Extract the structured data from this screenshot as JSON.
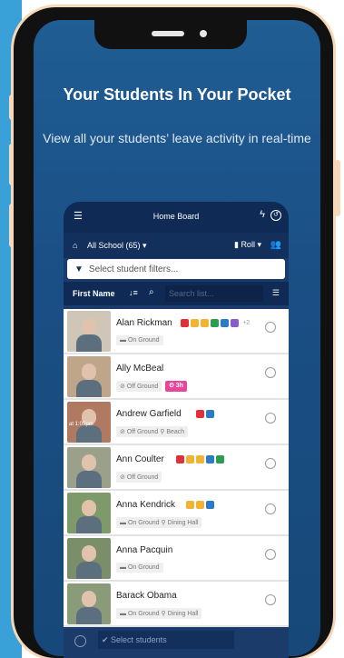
{
  "hero": {
    "headline": "Your Students In Your Pocket",
    "subline": "View all your students’ leave activity in real-time"
  },
  "app": {
    "topbar": {
      "title": "Home Board",
      "menu_icon": "hamburger-icon",
      "bolt_icon": "lightning-icon",
      "clock_icon": "clock-icon"
    },
    "school_selector": {
      "label": "All School (65)",
      "roll_label": "Roll",
      "people_icon": "group-icon"
    },
    "filter_placeholder": "Select student filters...",
    "sortbar": {
      "sort_field": "First Name",
      "search_placeholder": "Search list..."
    },
    "students": [
      {
        "name": "Alan Rickman",
        "tags": [
          "#e0303a",
          "#f2b233",
          "#f2b233",
          "#2a9d4e",
          "#2b7cc4",
          "#8b5cc9"
        ],
        "more": "+2",
        "status": "On Ground",
        "location": "",
        "time_badge": "",
        "photo_bg": "#cfc6b8",
        "overlay": ""
      },
      {
        "name": "Ally McBeal",
        "tags": [],
        "more": "",
        "status": "Off Ground",
        "location": "",
        "time_badge": "3h",
        "photo_bg": "#bfa58a",
        "overlay": ""
      },
      {
        "name": "Andrew Garfield",
        "tags": [
          "#e0303a",
          "#2b7cc4"
        ],
        "more": "",
        "status": "Off Ground",
        "location": "Beach",
        "time_badge": "",
        "photo_bg": "#b07a62",
        "overlay": "at 1:05pm"
      },
      {
        "name": "Ann Coulter",
        "tags": [
          "#e0303a",
          "#f2b233",
          "#f2b233",
          "#2b7cc4",
          "#2a9d4e"
        ],
        "more": "",
        "status": "Off Ground",
        "location": "",
        "time_badge": "",
        "photo_bg": "#9aa08a",
        "overlay": ""
      },
      {
        "name": "Anna Kendrick",
        "tags": [
          "#f2b233",
          "#f2b233",
          "#2b7cc4"
        ],
        "more": "",
        "status": "On Ground",
        "location": "Dining Hall",
        "time_badge": "",
        "photo_bg": "#7f9a6a",
        "overlay": ""
      },
      {
        "name": "Anna Pacquin",
        "tags": [],
        "more": "",
        "status": "On Ground",
        "location": "",
        "time_badge": "",
        "photo_bg": "#7a8e6a",
        "overlay": ""
      },
      {
        "name": "Barack Obama",
        "tags": [],
        "more": "",
        "status": "On Ground",
        "location": "Dining Hall",
        "time_badge": "",
        "photo_bg": "#8a9b7a",
        "overlay": ""
      }
    ],
    "bottom_select_label": "Select students"
  }
}
